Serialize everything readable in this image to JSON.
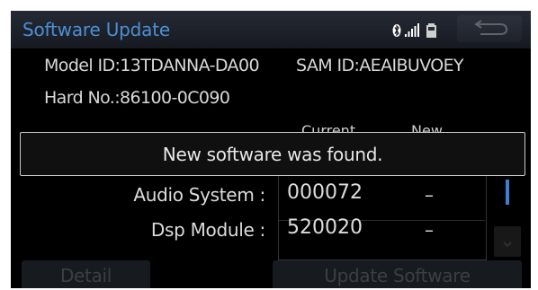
{
  "header": {
    "title": "Software Update"
  },
  "info": {
    "model_id": "Model ID:13TDANNA-DA00",
    "sam_id": "SAM ID:AEAIBUVOEY",
    "hard_no": "Hard No.:86100-0C090"
  },
  "columns": {
    "current": "Current",
    "new": "New"
  },
  "dialog": {
    "message": "New software was found."
  },
  "rows": [
    {
      "label": "Audio System :",
      "current": "000072",
      "new": "–"
    },
    {
      "label": "Dsp Module :",
      "current": "520020",
      "new": "–"
    }
  ],
  "buttons": {
    "detail": "Detail",
    "update": "Update Software"
  },
  "icons": {
    "bluetooth": "bluetooth-icon",
    "signal": "signal-icon",
    "battery": "battery-icon",
    "back": "back-arrow-icon"
  },
  "colors": {
    "title": "#4d8fd4",
    "accent": "#3f7fd0",
    "background": "#000000"
  }
}
